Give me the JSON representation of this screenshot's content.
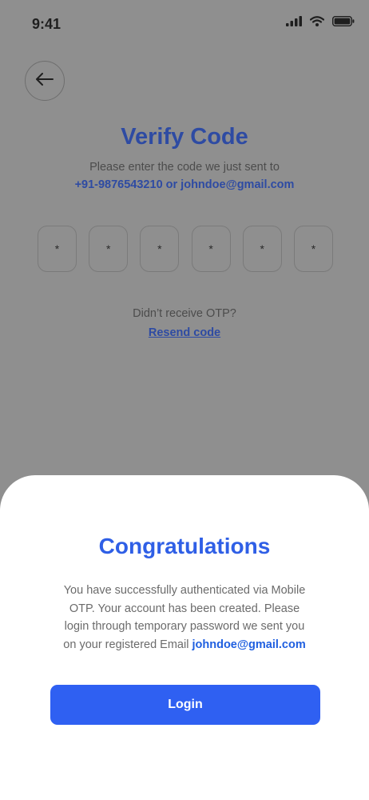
{
  "status_bar": {
    "time": "9:41",
    "icons": [
      "signal-icon",
      "wifi-icon",
      "battery-icon"
    ]
  },
  "header": {
    "back_icon": "arrow-left-icon"
  },
  "verify": {
    "title": "Verify Code",
    "subtitle": "Please enter the code we just sent to",
    "contact": "+91-9876543210 or johndoe@gmail.com",
    "otp_digits": [
      "*",
      "*",
      "*",
      "*",
      "*",
      "*"
    ],
    "didnt_receive": "Didn’t receive OTP?",
    "resend_label": "Resend code"
  },
  "modal": {
    "title": "Congratulations",
    "message_line1": "You have successfully authenticated via Mobile",
    "message_line2": "OTP. Your account has been created. Please",
    "message_line3": "login through temporary password we sent you",
    "message_line4_prefix": "on your registered Email",
    "email": "johndoe@gmail.com",
    "login_label": "Login"
  },
  "colors": {
    "overlay_bg": "#8f8f8f",
    "title_dim": "#2e4ba3",
    "accent": "#2f60f2",
    "sheet_bg": "#ffffff"
  }
}
